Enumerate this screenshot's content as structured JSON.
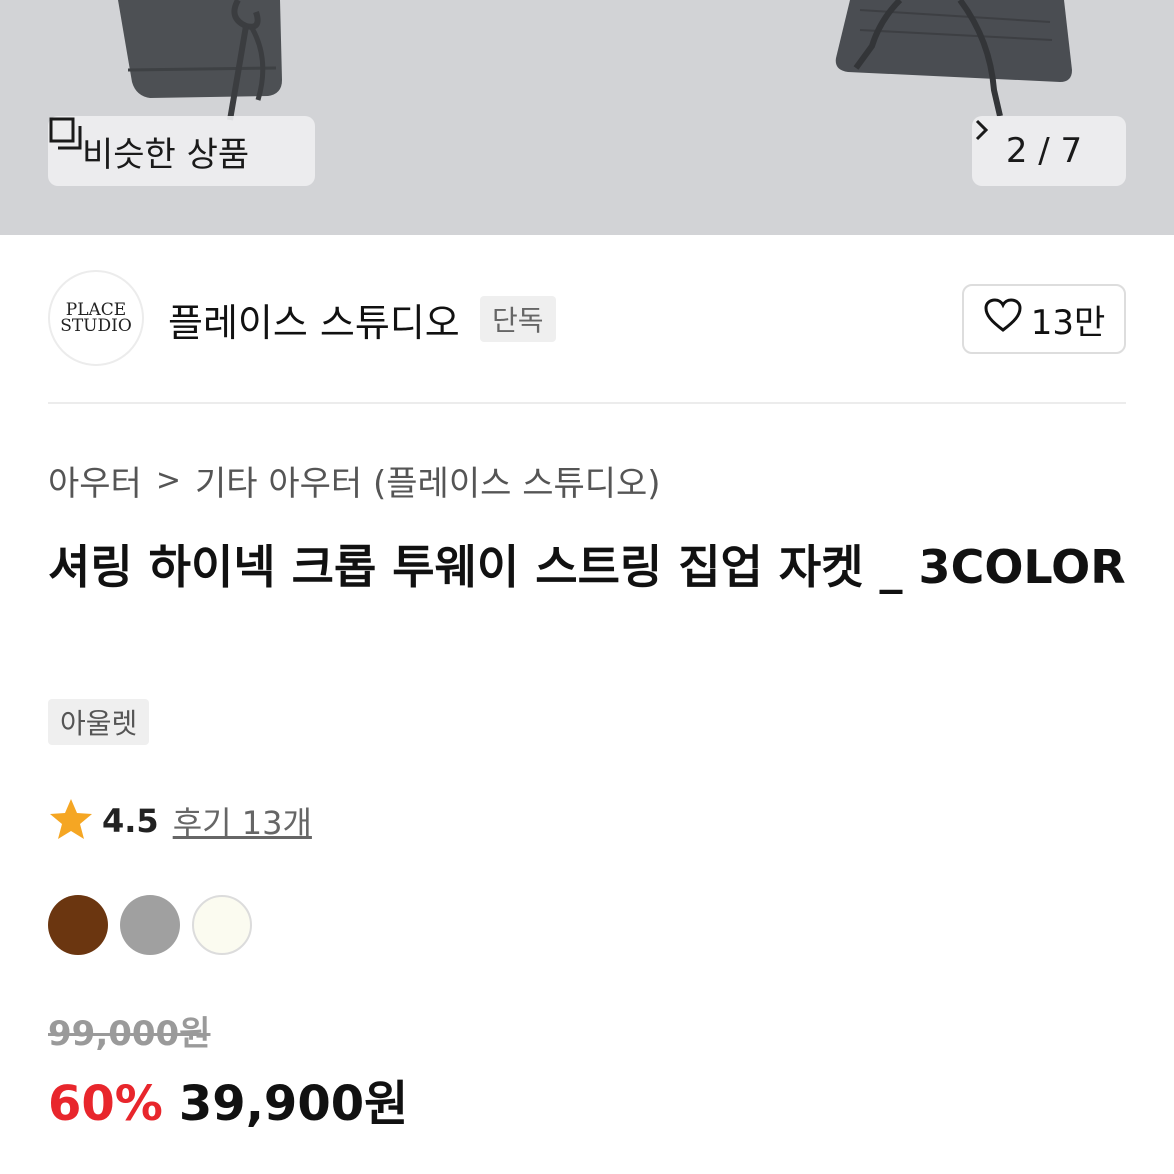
{
  "hero": {
    "similar_button_label": "비슷한 상품",
    "pager": {
      "text": "2 / 7"
    }
  },
  "brand": {
    "logo_text_line1": "PLACE",
    "logo_text_line2": "STUDIO",
    "name": "플레이스 스튜디오",
    "exclusive_badge": "단독",
    "like_count": "13만"
  },
  "breadcrumb": {
    "items": [
      "아우터",
      "기타 아우터 (플레이스 스튜디오)"
    ],
    "separator": ">"
  },
  "product": {
    "title": "셔링 하이넥 크롭 투웨이 스트링 집업 자켓 _ 3COLOR",
    "tag": "아울렛",
    "rating": "4.5",
    "review_link": "후기 13개",
    "colors": [
      "#6b3610",
      "#a0a0a0",
      "#fbfbf0"
    ],
    "original_price": "99,000원",
    "discount": "60%",
    "sale_price": "39,900원"
  },
  "icons": {
    "similar": "similar-products-icon",
    "pager_next": "chevron-right-icon",
    "like": "heart-outline-icon",
    "star": "star-icon"
  },
  "colors": {
    "accent_red": "#e8262c",
    "star": "#f5a623"
  }
}
